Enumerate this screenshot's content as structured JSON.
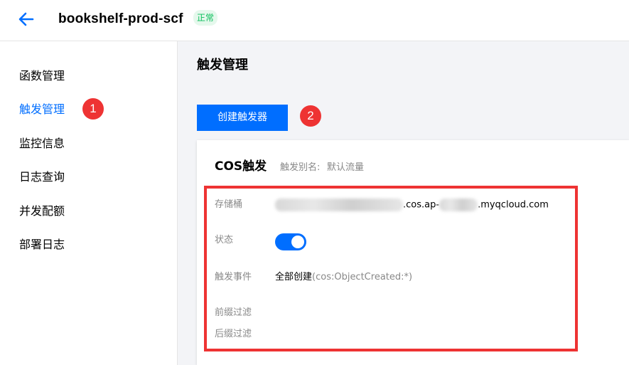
{
  "header": {
    "function_name": "bookshelf-prod-scf",
    "status": "正常",
    "back_icon": "arrow-left-icon",
    "accent_color": "#006eff",
    "status_color": "#0abf5b"
  },
  "sidebar": {
    "items": [
      {
        "label": "函数管理",
        "active": false
      },
      {
        "label": "触发管理",
        "active": true
      },
      {
        "label": "监控信息",
        "active": false
      },
      {
        "label": "日志查询",
        "active": false
      },
      {
        "label": "并发配额",
        "active": false
      },
      {
        "label": "部署日志",
        "active": false
      }
    ]
  },
  "annotations": {
    "step1": "1",
    "step2": "2",
    "color": "#ee3333"
  },
  "main": {
    "title": "触发管理",
    "create_button": "创建触发器",
    "trigger_card": {
      "title": "COS触发",
      "alias_label": "触发别名:",
      "alias_value": "默认流量",
      "bucket_label": "存储桶",
      "bucket_mid": ".cos.ap-",
      "bucket_suffix": ".myqcloud.com",
      "status_label": "状态",
      "status_on": true,
      "event_label": "触发事件",
      "event_value": "全部创建",
      "event_code": "(cos:ObjectCreated:*)",
      "prefix_label": "前缀过滤",
      "suffix_label": "后缀过滤"
    }
  }
}
